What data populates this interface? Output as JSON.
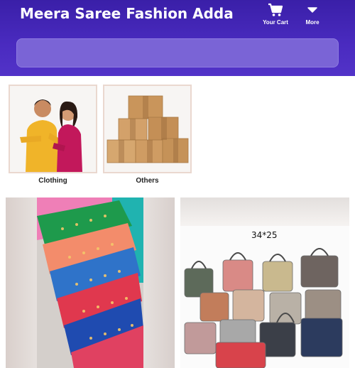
{
  "header": {
    "shop_name": "Meera Saree Fashion Adda",
    "cart_label": "Your Cart",
    "more_label": "More",
    "cart_icon": "cart-icon",
    "more_icon": "chevron-down-icon",
    "search_placeholder": ""
  },
  "categories": [
    {
      "label": "Clothing",
      "image": "couple-photo"
    },
    {
      "label": "Others",
      "image": "cardboard-boxes"
    }
  ],
  "products": [
    {
      "image": "folded-sarees"
    },
    {
      "image": "handbags",
      "overlay_text": "34*25"
    }
  ],
  "colors": {
    "header_bg": "#4a2bc0",
    "search_bg": "#7a64d6",
    "text_on_header": "#ffffff"
  }
}
